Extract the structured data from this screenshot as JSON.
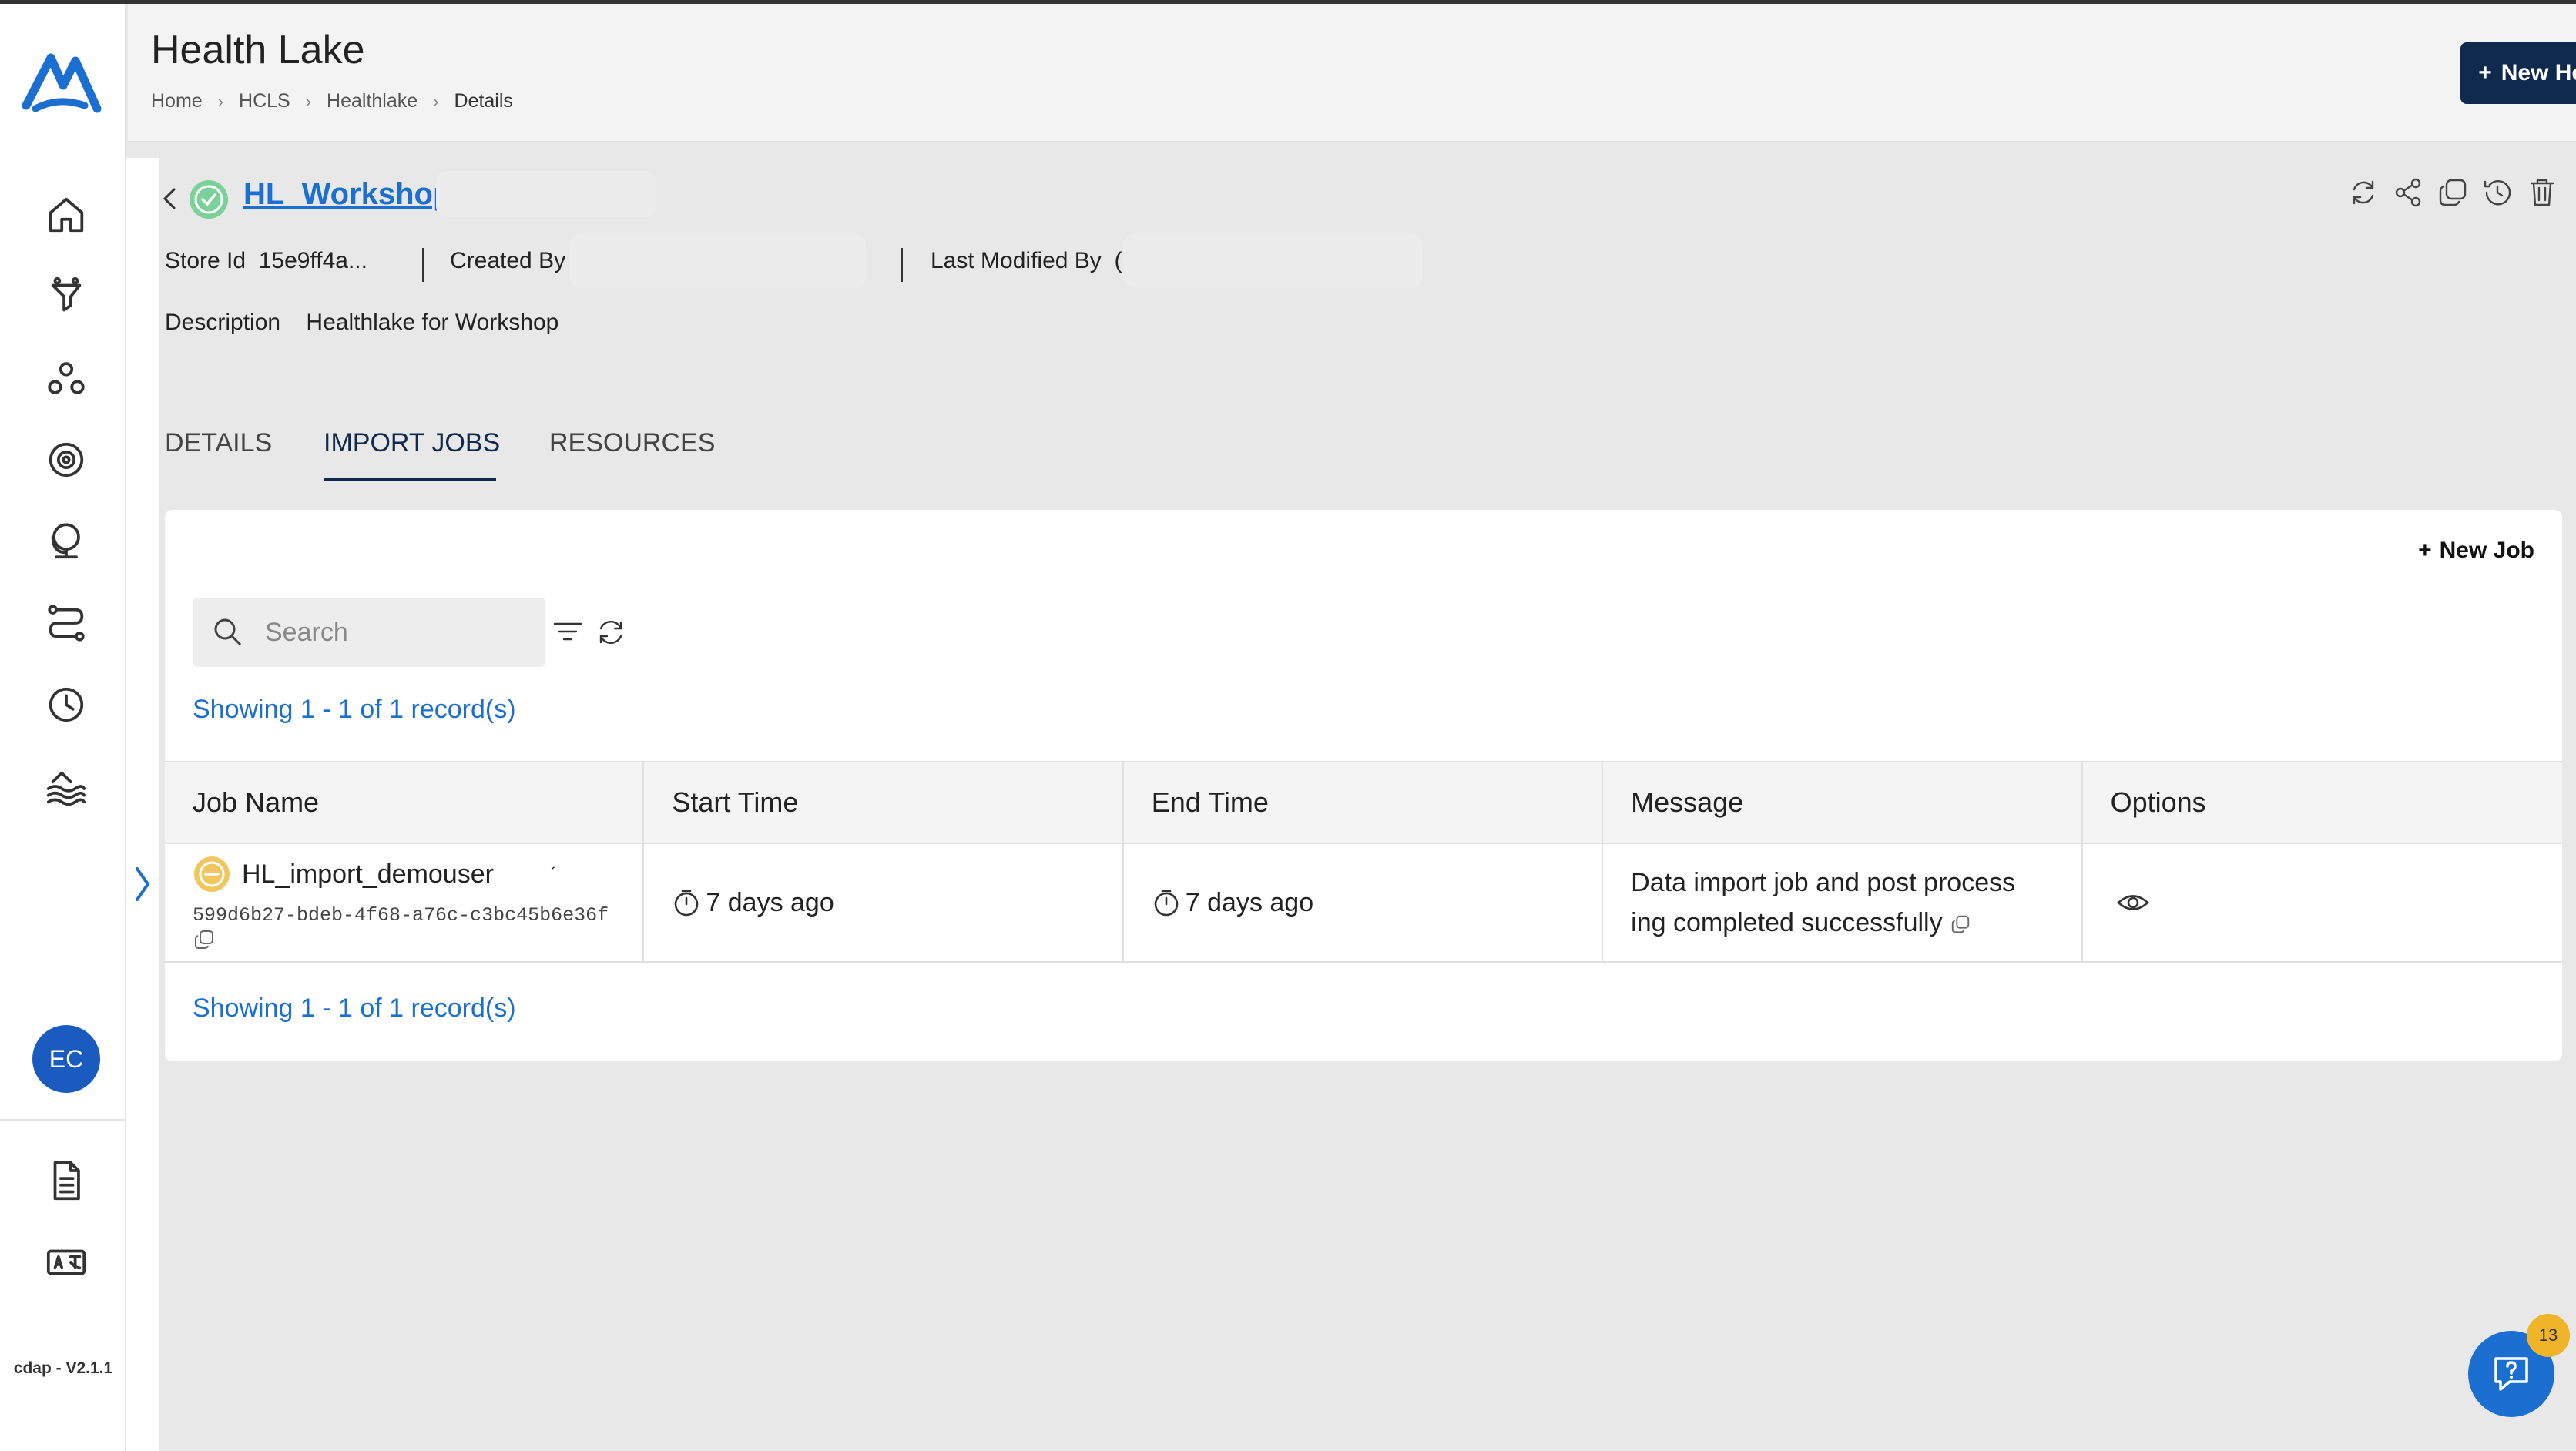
{
  "app": {
    "version": "cdap - V2.1.1",
    "user_initials": "EC",
    "brand_color": "#1a6fd1",
    "primary_color": "#0f2a4d"
  },
  "header": {
    "title": "Health Lake",
    "breadcrumb": [
      "Home",
      "HCLS",
      "Healthlake",
      "Details"
    ],
    "new_button": "New Healthlake"
  },
  "detail": {
    "name": "HL_Workshop_",
    "store_id_label": "Store Id",
    "store_id_value": "15e9ff4a...",
    "created_by_label": "Created By",
    "last_modified_label": "Last Modified By",
    "last_modified_value": "(",
    "description_label": "Description",
    "description_value": "Healthlake for Workshop"
  },
  "tabs": [
    {
      "label": "DETAILS",
      "active": false
    },
    {
      "label": "IMPORT JOBS",
      "active": true
    },
    {
      "label": "RESOURCES",
      "active": false
    }
  ],
  "jobs": {
    "new_job_label": "New Job",
    "search_placeholder": "Search",
    "records_top": "Showing 1 - 1 of 1 record(s)",
    "records_bottom": "Showing 1 - 1 of 1 record(s)",
    "columns": [
      "Job Name",
      "Start Time",
      "End Time",
      "Message",
      "Options"
    ],
    "rows": [
      {
        "job_name": "HL_import_demouser",
        "job_mark": "´",
        "job_id": "599d6b27-bdeb-4f68-a76c-c3bc45b6e36f",
        "start_time": "7 days ago",
        "end_time": "7 days ago",
        "message_line1": "Data import job and post process",
        "message_line2": "ing completed successfully"
      }
    ]
  },
  "help": {
    "badge_count": "13"
  },
  "icons": {
    "sidebar": [
      "home-icon",
      "funnel-icon",
      "users-icon",
      "settings-gear-icon",
      "globe-stand-icon",
      "workflow-icon",
      "clock-icon",
      "lake-waves-icon",
      "document-icon",
      "translate-icon"
    ],
    "actions": [
      "refresh-icon",
      "share-icon",
      "copy-icon",
      "history-icon",
      "trash-icon"
    ]
  }
}
